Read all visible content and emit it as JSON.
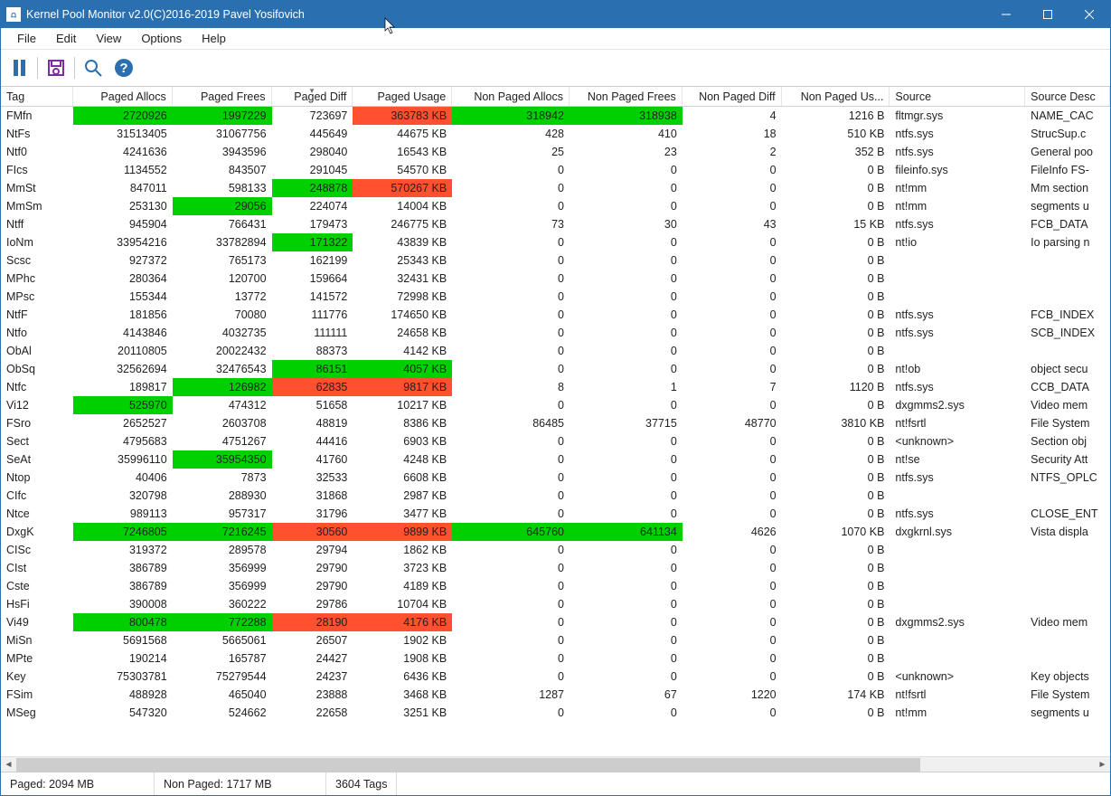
{
  "window": {
    "title": "Kernel Pool Monitor v2.0(C)2016-2019 Pavel Yosifovich"
  },
  "menu": {
    "file": "File",
    "edit": "Edit",
    "view": "View",
    "options": "Options",
    "help": "Help"
  },
  "toolbar": {
    "pause": "pause-icon",
    "save": "save-icon",
    "search": "search-icon",
    "help": "help-icon"
  },
  "columns": [
    {
      "key": "tag",
      "label": "Tag",
      "align": "left"
    },
    {
      "key": "pa",
      "label": "Paged Allocs",
      "align": "right"
    },
    {
      "key": "pf",
      "label": "Paged Frees",
      "align": "right"
    },
    {
      "key": "pd",
      "label": "Paged Diff",
      "align": "right",
      "sorted": true
    },
    {
      "key": "pu",
      "label": "Paged Usage",
      "align": "right"
    },
    {
      "key": "npa",
      "label": "Non Paged Allocs",
      "align": "right"
    },
    {
      "key": "npf",
      "label": "Non Paged Frees",
      "align": "right"
    },
    {
      "key": "npd",
      "label": "Non Paged Diff",
      "align": "right"
    },
    {
      "key": "npu",
      "label": "Non Paged Us...",
      "align": "right"
    },
    {
      "key": "src",
      "label": "Source",
      "align": "left"
    },
    {
      "key": "desc",
      "label": "Source Desc",
      "align": "left"
    }
  ],
  "rows": [
    {
      "tag": "FMfn",
      "pa": "2720926",
      "pf": "1997229",
      "pd": "723697",
      "pu": "363783 KB",
      "npa": "318942",
      "npf": "318938",
      "npd": "4",
      "npu": "1216 B",
      "src": "fltmgr.sys",
      "desc": "NAME_CAC",
      "hl": {
        "pa": "g",
        "pf": "g",
        "pu": "r",
        "npa": "g",
        "npf": "g"
      }
    },
    {
      "tag": "NtFs",
      "pa": "31513405",
      "pf": "31067756",
      "pd": "445649",
      "pu": "44675 KB",
      "npa": "428",
      "npf": "410",
      "npd": "18",
      "npu": "510 KB",
      "src": "ntfs.sys",
      "desc": "StrucSup.c"
    },
    {
      "tag": "Ntf0",
      "pa": "4241636",
      "pf": "3943596",
      "pd": "298040",
      "pu": "16543 KB",
      "npa": "25",
      "npf": "23",
      "npd": "2",
      "npu": "352 B",
      "src": "ntfs.sys",
      "desc": "General poo"
    },
    {
      "tag": "FIcs",
      "pa": "1134552",
      "pf": "843507",
      "pd": "291045",
      "pu": "54570 KB",
      "npa": "0",
      "npf": "0",
      "npd": "0",
      "npu": "0 B",
      "src": "fileinfo.sys",
      "desc": "FileInfo FS-"
    },
    {
      "tag": "MmSt",
      "pa": "847011",
      "pf": "598133",
      "pd": "248878",
      "pu": "570267 KB",
      "npa": "0",
      "npf": "0",
      "npd": "0",
      "npu": "0 B",
      "src": "nt!mm",
      "desc": "Mm section",
      "hl": {
        "pd": "g",
        "pu": "r"
      }
    },
    {
      "tag": "MmSm",
      "pa": "253130",
      "pf": "29056",
      "pd": "224074",
      "pu": "14004 KB",
      "npa": "0",
      "npf": "0",
      "npd": "0",
      "npu": "0 B",
      "src": "nt!mm",
      "desc": "segments u",
      "hl": {
        "pf": "g"
      }
    },
    {
      "tag": "Ntff",
      "pa": "945904",
      "pf": "766431",
      "pd": "179473",
      "pu": "246775 KB",
      "npa": "73",
      "npf": "30",
      "npd": "43",
      "npu": "15 KB",
      "src": "ntfs.sys",
      "desc": "FCB_DATA"
    },
    {
      "tag": "IoNm",
      "pa": "33954216",
      "pf": "33782894",
      "pd": "171322",
      "pu": "43839 KB",
      "npa": "0",
      "npf": "0",
      "npd": "0",
      "npu": "0 B",
      "src": "nt!io",
      "desc": "Io parsing n",
      "hl": {
        "pd": "g"
      }
    },
    {
      "tag": "Scsc",
      "pa": "927372",
      "pf": "765173",
      "pd": "162199",
      "pu": "25343 KB",
      "npa": "0",
      "npf": "0",
      "npd": "0",
      "npu": "0 B",
      "src": "",
      "desc": ""
    },
    {
      "tag": "MPhc",
      "pa": "280364",
      "pf": "120700",
      "pd": "159664",
      "pu": "32431 KB",
      "npa": "0",
      "npf": "0",
      "npd": "0",
      "npu": "0 B",
      "src": "",
      "desc": ""
    },
    {
      "tag": "MPsc",
      "pa": "155344",
      "pf": "13772",
      "pd": "141572",
      "pu": "72998 KB",
      "npa": "0",
      "npf": "0",
      "npd": "0",
      "npu": "0 B",
      "src": "",
      "desc": ""
    },
    {
      "tag": "NtfF",
      "pa": "181856",
      "pf": "70080",
      "pd": "111776",
      "pu": "174650 KB",
      "npa": "0",
      "npf": "0",
      "npd": "0",
      "npu": "0 B",
      "src": "ntfs.sys",
      "desc": "FCB_INDEX"
    },
    {
      "tag": "Ntfo",
      "pa": "4143846",
      "pf": "4032735",
      "pd": "111111",
      "pu": "24658 KB",
      "npa": "0",
      "npf": "0",
      "npd": "0",
      "npu": "0 B",
      "src": "ntfs.sys",
      "desc": "SCB_INDEX"
    },
    {
      "tag": "ObAl",
      "pa": "20110805",
      "pf": "20022432",
      "pd": "88373",
      "pu": "4142 KB",
      "npa": "0",
      "npf": "0",
      "npd": "0",
      "npu": "0 B",
      "src": "",
      "desc": ""
    },
    {
      "tag": "ObSq",
      "pa": "32562694",
      "pf": "32476543",
      "pd": "86151",
      "pu": "4057 KB",
      "npa": "0",
      "npf": "0",
      "npd": "0",
      "npu": "0 B",
      "src": "nt!ob",
      "desc": "object secu",
      "hl": {
        "pd": "g",
        "pu": "g"
      }
    },
    {
      "tag": "Ntfc",
      "pa": "189817",
      "pf": "126982",
      "pd": "62835",
      "pu": "9817 KB",
      "npa": "8",
      "npf": "1",
      "npd": "7",
      "npu": "1120 B",
      "src": "ntfs.sys",
      "desc": "CCB_DATA",
      "hl": {
        "pf": "g",
        "pd": "r",
        "pu": "r"
      }
    },
    {
      "tag": "Vi12",
      "pa": "525970",
      "pf": "474312",
      "pd": "51658",
      "pu": "10217 KB",
      "npa": "0",
      "npf": "0",
      "npd": "0",
      "npu": "0 B",
      "src": "dxgmms2.sys",
      "desc": "Video mem",
      "hl": {
        "pa": "g"
      }
    },
    {
      "tag": "FSro",
      "pa": "2652527",
      "pf": "2603708",
      "pd": "48819",
      "pu": "8386 KB",
      "npa": "86485",
      "npf": "37715",
      "npd": "48770",
      "npu": "3810 KB",
      "src": "nt!fsrtl",
      "desc": "File System"
    },
    {
      "tag": "Sect",
      "pa": "4795683",
      "pf": "4751267",
      "pd": "44416",
      "pu": "6903 KB",
      "npa": "0",
      "npf": "0",
      "npd": "0",
      "npu": "0 B",
      "src": "<unknown>",
      "desc": "Section obj"
    },
    {
      "tag": "SeAt",
      "pa": "35996110",
      "pf": "35954350",
      "pd": "41760",
      "pu": "4248 KB",
      "npa": "0",
      "npf": "0",
      "npd": "0",
      "npu": "0 B",
      "src": "nt!se",
      "desc": "Security Att",
      "hl": {
        "pf": "g"
      }
    },
    {
      "tag": "Ntop",
      "pa": "40406",
      "pf": "7873",
      "pd": "32533",
      "pu": "6608 KB",
      "npa": "0",
      "npf": "0",
      "npd": "0",
      "npu": "0 B",
      "src": "ntfs.sys",
      "desc": "NTFS_OPLC"
    },
    {
      "tag": "CIfc",
      "pa": "320798",
      "pf": "288930",
      "pd": "31868",
      "pu": "2987 KB",
      "npa": "0",
      "npf": "0",
      "npd": "0",
      "npu": "0 B",
      "src": "",
      "desc": ""
    },
    {
      "tag": "Ntce",
      "pa": "989113",
      "pf": "957317",
      "pd": "31796",
      "pu": "3477 KB",
      "npa": "0",
      "npf": "0",
      "npd": "0",
      "npu": "0 B",
      "src": "ntfs.sys",
      "desc": "CLOSE_ENT"
    },
    {
      "tag": "DxgK",
      "pa": "7246805",
      "pf": "7216245",
      "pd": "30560",
      "pu": "9899 KB",
      "npa": "645760",
      "npf": "641134",
      "npd": "4626",
      "npu": "1070 KB",
      "src": "dxgkrnl.sys",
      "desc": "Vista displa",
      "hl": {
        "pa": "g",
        "pf": "g",
        "pd": "r",
        "pu": "r",
        "npa": "g",
        "npf": "g"
      }
    },
    {
      "tag": "CISc",
      "pa": "319372",
      "pf": "289578",
      "pd": "29794",
      "pu": "1862 KB",
      "npa": "0",
      "npf": "0",
      "npd": "0",
      "npu": "0 B",
      "src": "",
      "desc": ""
    },
    {
      "tag": "CIst",
      "pa": "386789",
      "pf": "356999",
      "pd": "29790",
      "pu": "3723 KB",
      "npa": "0",
      "npf": "0",
      "npd": "0",
      "npu": "0 B",
      "src": "",
      "desc": ""
    },
    {
      "tag": "Cste",
      "pa": "386789",
      "pf": "356999",
      "pd": "29790",
      "pu": "4189 KB",
      "npa": "0",
      "npf": "0",
      "npd": "0",
      "npu": "0 B",
      "src": "",
      "desc": ""
    },
    {
      "tag": "HsFi",
      "pa": "390008",
      "pf": "360222",
      "pd": "29786",
      "pu": "10704 KB",
      "npa": "0",
      "npf": "0",
      "npd": "0",
      "npu": "0 B",
      "src": "",
      "desc": ""
    },
    {
      "tag": "Vi49",
      "pa": "800478",
      "pf": "772288",
      "pd": "28190",
      "pu": "4176 KB",
      "npa": "0",
      "npf": "0",
      "npd": "0",
      "npu": "0 B",
      "src": "dxgmms2.sys",
      "desc": "Video mem",
      "hl": {
        "pa": "g",
        "pf": "g",
        "pd": "r",
        "pu": "r"
      }
    },
    {
      "tag": "MiSn",
      "pa": "5691568",
      "pf": "5665061",
      "pd": "26507",
      "pu": "1902 KB",
      "npa": "0",
      "npf": "0",
      "npd": "0",
      "npu": "0 B",
      "src": "",
      "desc": ""
    },
    {
      "tag": "MPte",
      "pa": "190214",
      "pf": "165787",
      "pd": "24427",
      "pu": "1908 KB",
      "npa": "0",
      "npf": "0",
      "npd": "0",
      "npu": "0 B",
      "src": "",
      "desc": ""
    },
    {
      "tag": "Key ",
      "pa": "75303781",
      "pf": "75279544",
      "pd": "24237",
      "pu": "6436 KB",
      "npa": "0",
      "npf": "0",
      "npd": "0",
      "npu": "0 B",
      "src": "<unknown>",
      "desc": "Key objects"
    },
    {
      "tag": "FSim",
      "pa": "488928",
      "pf": "465040",
      "pd": "23888",
      "pu": "3468 KB",
      "npa": "1287",
      "npf": "67",
      "npd": "1220",
      "npu": "174 KB",
      "src": "nt!fsrtl",
      "desc": "File System"
    },
    {
      "tag": "MSeg",
      "pa": "547320",
      "pf": "524662",
      "pd": "22658",
      "pu": "3251 KB",
      "npa": "0",
      "npf": "0",
      "npd": "0",
      "npu": "0 B",
      "src": "nt!mm",
      "desc": "segments u"
    }
  ],
  "status": {
    "paged": "Paged: 2094 MB",
    "nonpaged": "Non Paged: 1717 MB",
    "tags": "3604 Tags"
  }
}
